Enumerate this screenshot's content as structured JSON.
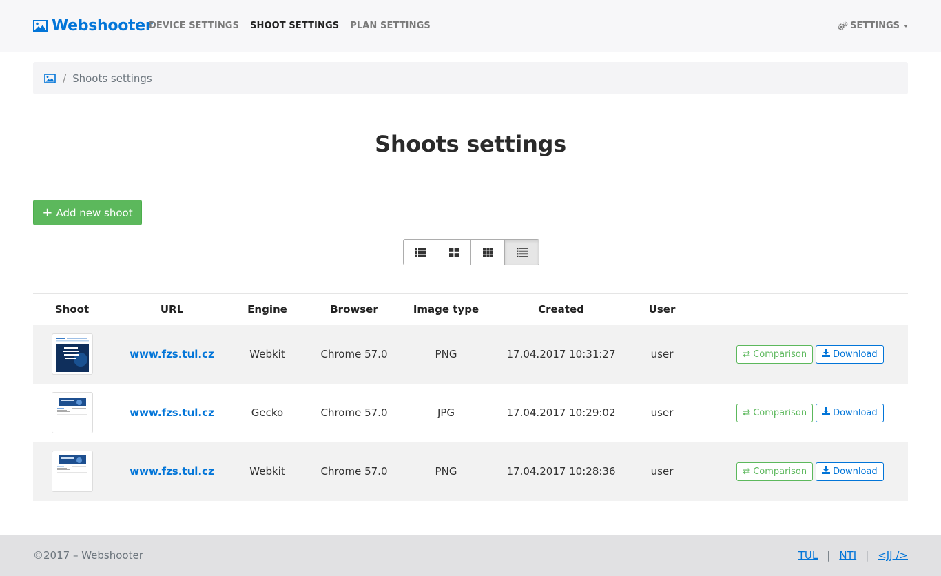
{
  "brand": {
    "name": "Webshooter",
    "icon": "image-icon",
    "color": "#0275d8"
  },
  "nav": {
    "items": [
      {
        "label": "DEVICE SETTINGS",
        "active": false
      },
      {
        "label": "SHOOT SETTINGS",
        "active": true
      },
      {
        "label": "PLAN SETTINGS",
        "active": false
      }
    ],
    "settings_label": "SETTINGS"
  },
  "breadcrumb": {
    "separator": "/",
    "current": "Shoots settings"
  },
  "page": {
    "title": "Shoots settings"
  },
  "add_button": {
    "label": "Add new shoot",
    "color": "#5cb85c"
  },
  "view_toggle": {
    "options": [
      "list-view",
      "grid-2x2",
      "grid-3x3",
      "detailed-list"
    ],
    "active": "detailed-list"
  },
  "table": {
    "headers": [
      "Shoot",
      "URL",
      "Engine",
      "Browser",
      "Image type",
      "Created",
      "User",
      ""
    ],
    "rows": [
      {
        "url": "www.fzs.tul.cz",
        "engine": "Webkit",
        "browser": "Chrome 57.0",
        "image_type": "PNG",
        "created": "17.04.2017 10:31:27",
        "user": "user",
        "thumb": "dark"
      },
      {
        "url": "www.fzs.tul.cz",
        "engine": "Gecko",
        "browser": "Chrome 57.0",
        "image_type": "JPG",
        "created": "17.04.2017 10:29:02",
        "user": "user",
        "thumb": "light"
      },
      {
        "url": "www.fzs.tul.cz",
        "engine": "Webkit",
        "browser": "Chrome 57.0",
        "image_type": "PNG",
        "created": "17.04.2017 10:28:36",
        "user": "user",
        "thumb": "light"
      }
    ],
    "compare_label": "Comparison",
    "download_label": "Download"
  },
  "footer": {
    "copyright": "©2017 – Webshooter",
    "links": [
      "TUL",
      "NTI",
      "<JJ />"
    ],
    "separator": "|"
  }
}
